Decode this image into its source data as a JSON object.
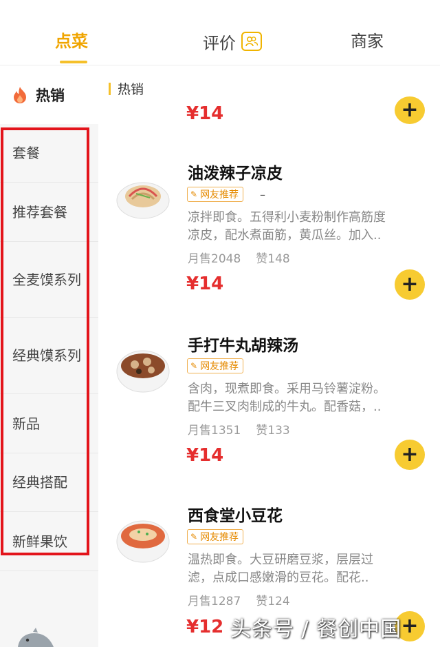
{
  "tabs": {
    "order": "点菜",
    "reviews": "评价",
    "merchant": "商家"
  },
  "sidebar": {
    "hot": "热销",
    "items": [
      "套餐",
      "推荐套餐",
      "全麦馍系列",
      "经典馍系列",
      "新品",
      "经典搭配",
      "新鲜果饮"
    ]
  },
  "main": {
    "section_title": "热销",
    "top_price": "¥14",
    "dishes": [
      {
        "name": "油泼辣子凉皮",
        "tag": "网友推荐",
        "dash": "–",
        "desc1": "凉拌即食。五得利小麦粉制作高筋度",
        "desc2": "凉皮，配水煮面筋，黄瓜丝。加入..",
        "sales": "月售2048",
        "likes": "赞148",
        "price": "¥14"
      },
      {
        "name": "手打牛丸胡辣汤",
        "tag": "网友推荐",
        "desc1": "含肉，现煮即食。采用马铃薯淀粉。",
        "desc2": "配牛三叉肉制成的牛丸。配香菇，..",
        "sales": "月售1351",
        "likes": "赞133",
        "price": "¥14"
      },
      {
        "name": "西食堂小豆花",
        "tag": "网友推荐",
        "desc1": "温热即食。大豆研磨豆浆，层层过",
        "desc2": "滤，点成口感嫩滑的豆花。配花..",
        "sales": "月售1287",
        "likes": "赞124",
        "price": "¥12"
      }
    ]
  },
  "watermark": "头条号 / 餐创中国",
  "colors": {
    "accent": "#f5c02a",
    "price": "#e52e2e",
    "highlight": "#e3141b"
  }
}
